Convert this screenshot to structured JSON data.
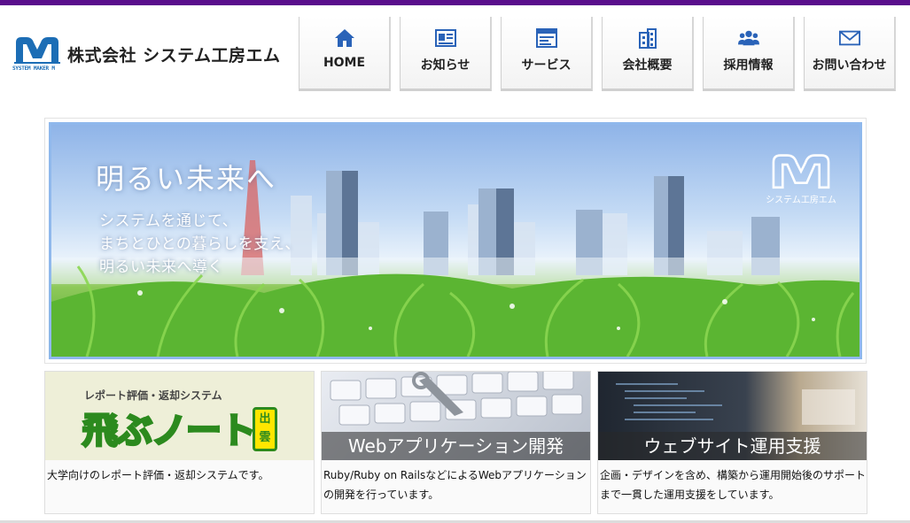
{
  "header": {
    "logo_caption": "SYSTEM MAKER M",
    "company_name": "株式会社 システム工房エム"
  },
  "nav": {
    "items": [
      {
        "label": "HOME",
        "icon": "home-icon"
      },
      {
        "label": "お知らせ",
        "icon": "news-icon"
      },
      {
        "label": "サービス",
        "icon": "service-window-icon"
      },
      {
        "label": "会社概要",
        "icon": "building-icon"
      },
      {
        "label": "採用情報",
        "icon": "people-icon"
      },
      {
        "label": "お問い合わせ",
        "icon": "mail-icon"
      }
    ]
  },
  "hero": {
    "title": "明るい未来へ",
    "lines": [
      "システムを通じて、",
      "まちとひとの暮らしを支え、",
      "明るい未来へ導く"
    ],
    "logo_caption": "システム工房エム"
  },
  "cards": [
    {
      "banner_small": "レポート評価・返却システム",
      "banner_big": "飛ぶノート",
      "banner_badge": "出雲",
      "description": "大学向けのレポート評価・返却システムです。"
    },
    {
      "overlay": "Webアプリケーション開発",
      "description": "Ruby/Ruby on RailsなどによるWebアプリケーションの開発を行っています。"
    },
    {
      "overlay": "ウェブサイト運用支援",
      "description": "企画・デザインを含め、構築から運用開始後のサポートまで一貫した運用支援をしています。"
    }
  ],
  "colors": {
    "top_bar": "#5a0f8c",
    "nav_icon": "#2a63b8",
    "logo_blue": "#1c6db5"
  }
}
